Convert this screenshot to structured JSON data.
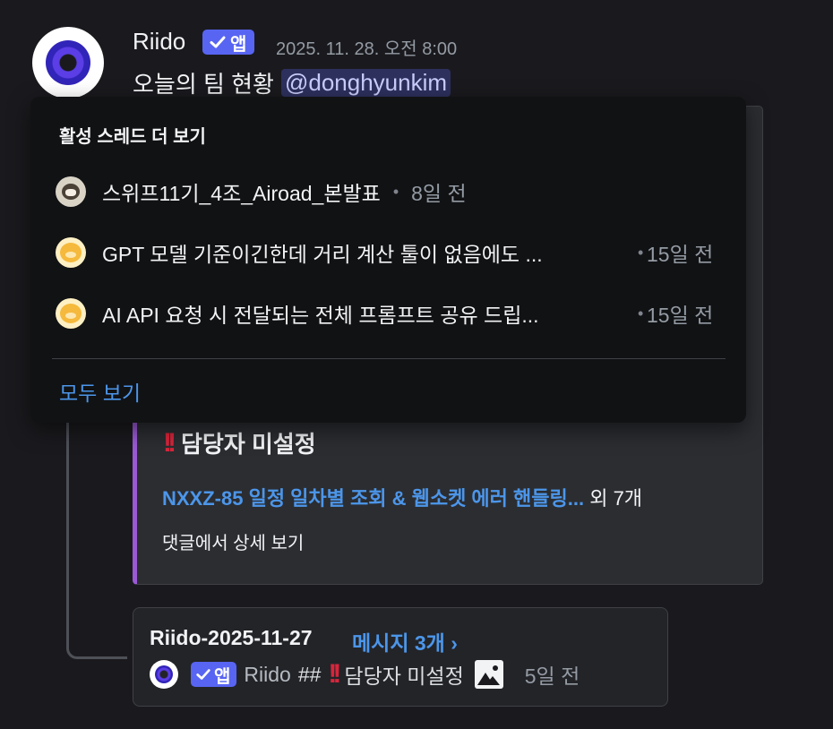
{
  "message": {
    "author": "Riido",
    "app_badge": "앱",
    "timestamp": "2025. 11. 28. 오전 8:00",
    "text": "오늘의 팀 현황",
    "mention": "@donghyunkim"
  },
  "embed": {
    "title": "담당자 미설정",
    "link": "NXXZ-85 일정 일차별 조회 & 웹소켓 에러 핸들링...",
    "link_suffix": "외 7개",
    "footer": "댓글에서 상세 보기",
    "accent_color": "#9b59d6"
  },
  "thread_card": {
    "name": "Riido-2025-11-27",
    "message_count": "메시지 3개 ›",
    "preview_badge": "앱",
    "preview_author": "Riido",
    "preview_text": "##",
    "preview_title": "담당자 미설정",
    "preview_time": "5일 전"
  },
  "active_threads_popup": {
    "header": "활성 스레드 더 보기",
    "threads": [
      {
        "title": "스위프11기_4조_Airoad_본발표",
        "ago": "8일 전",
        "avatar": "cat-avatar"
      },
      {
        "title": "GPT 모델 기준이긴한데 거리 계산 툴이 없음에도 ...",
        "ago": "15일 전",
        "avatar": "bear-avatar"
      },
      {
        "title": "AI API 요청 시 전달되는 전체 프롬프트 공유 드립...",
        "ago": "15일 전",
        "avatar": "bear-avatar"
      }
    ],
    "view_all": "모두 보기"
  },
  "colors": {
    "background": "#1a1a1e",
    "link": "#4c96ea",
    "badge": "#5865f2",
    "alert": "#d9253b"
  }
}
